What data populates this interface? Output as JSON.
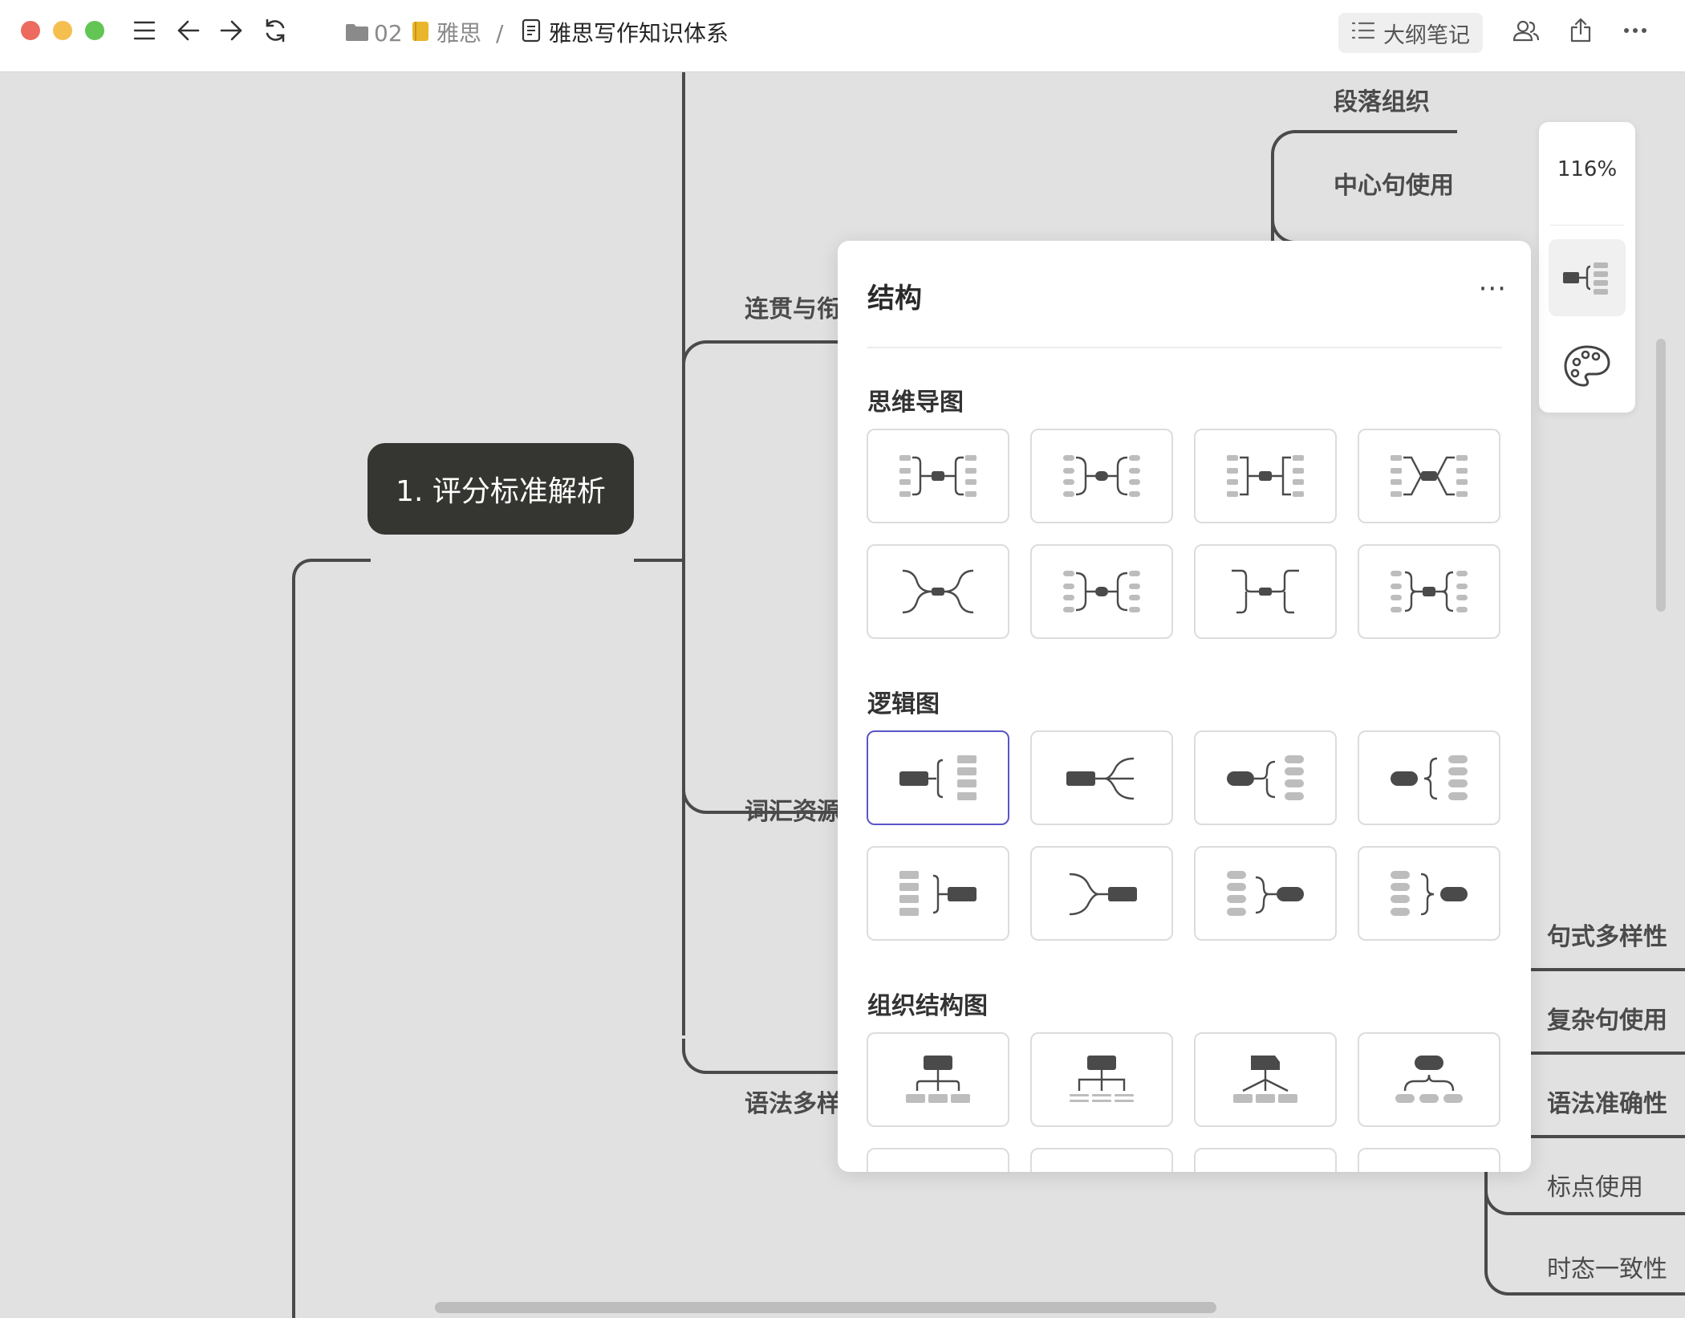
{
  "toolbar": {
    "folder_label": "02",
    "notebook_label": "雅思",
    "separator": "/",
    "doc_title": "雅思写作知识体系",
    "outline_button": "大纲笔记"
  },
  "icons": {
    "folder": "folder-icon",
    "notebook": "notebook-icon",
    "doc": "document-icon",
    "menu": "menu-icon",
    "back": "arrow-left-icon",
    "forward": "arrow-right-icon",
    "refresh": "refresh-icon",
    "collab": "collaborators-icon",
    "share": "share-icon",
    "more": "more-icon",
    "palette": "palette-icon",
    "structure": "structure-icon"
  },
  "colors": {
    "root_node": "#353532",
    "selected_border": "#5b55c8",
    "canvas_bg": "#e1e1e1"
  },
  "mindmap": {
    "root": "1. 评分标准解析",
    "branch_coherence": "连贯与衔",
    "branch_vocab": "词汇资源",
    "branch_grammar": "语法多样",
    "sub_paragraph": "段落组织",
    "sub_topic_sentence": "中心句使用",
    "sub_sentence_variety": "句式多样性",
    "sub_complex_sentence": "复杂句使用",
    "sub_grammar_accuracy": "语法准确性",
    "sub_punctuation": "标点使用",
    "sub_tense": "时态一致性"
  },
  "zoom": {
    "level": "116%"
  },
  "panel": {
    "title": "结构",
    "more": "···",
    "sections": [
      {
        "title": "思维导图"
      },
      {
        "title": "逻辑图"
      },
      {
        "title": "组织结构图"
      }
    ],
    "selected_tile": "logic-1"
  }
}
